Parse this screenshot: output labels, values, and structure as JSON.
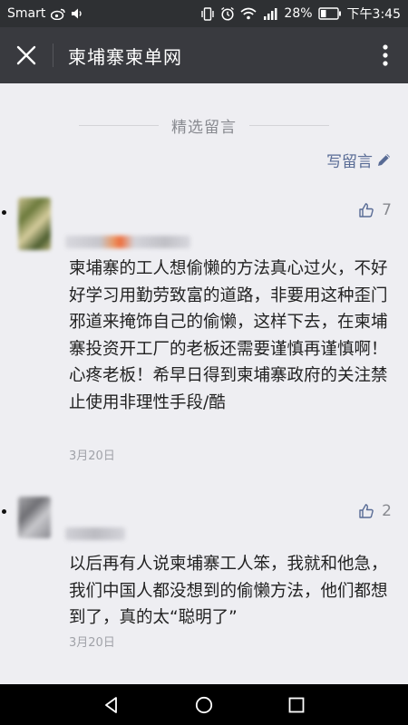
{
  "status_bar": {
    "carrier": "Smart",
    "battery": "28%",
    "time": "下午3:45",
    "icons": [
      "weibo-icon",
      "volume-icon",
      "vibrate-icon",
      "alarm-icon",
      "wifi-icon",
      "signal-icon",
      "battery-icon"
    ]
  },
  "header": {
    "title": "柬埔寨柬单网",
    "close_icon": "close-icon",
    "more_icon": "more-vertical-icon"
  },
  "comments_section": {
    "title": "精选留言",
    "write_label": "写留言"
  },
  "comments": [
    {
      "likes": "7",
      "text": "柬埔寨的工人想偷懒的方法真心过火，不好好学习用勤劳致富的道路，非要用这种歪门邪道来掩饰自己的偷懒，这样下去，在柬埔寨投资开工厂的老板还需要谨慎再谨慎啊！心疼老板！希早日得到柬埔寨政府的关注禁止使用非理性手段/酷",
      "date": "3月20日"
    },
    {
      "likes": "2",
      "text": "以后再有人说柬埔寨工人笨，我就和他急，我们中国人都没想到的偷懒方法，他们都想到了，真的太“聪明了”",
      "date": "3月20日"
    }
  ],
  "colors": {
    "status_bar_bg": "#2e3033",
    "title_bar_bg": "#393a3f",
    "page_bg": "#eeeef2",
    "link": "#586b95",
    "nav_bar_bg": "#000000"
  }
}
